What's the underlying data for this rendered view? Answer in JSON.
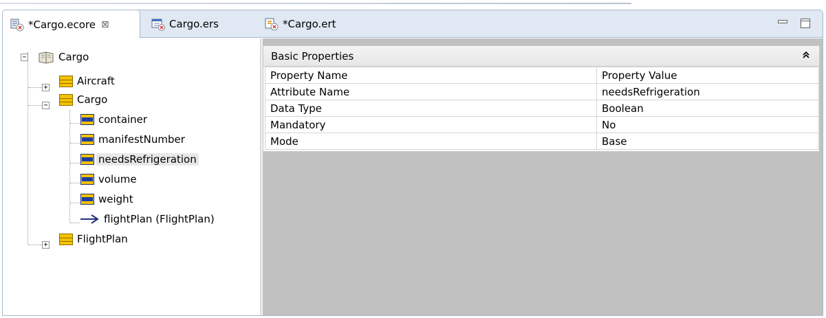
{
  "tabs": [
    {
      "label": "*Cargo.ecore",
      "active": true,
      "close": "⊠",
      "icon": "ecore-model-icon"
    },
    {
      "label": "Cargo.ers",
      "active": false,
      "icon": "ers-file-icon"
    },
    {
      "label": "*Cargo.ert",
      "active": false,
      "icon": "ert-file-icon"
    }
  ],
  "tree": {
    "root": "Cargo",
    "items": [
      {
        "label": "Aircraft",
        "icon": "eclass-icon",
        "expander": "+"
      },
      {
        "label": "Cargo",
        "icon": "eclass-icon",
        "expander": "−"
      },
      {
        "label": "container",
        "icon": "eattribute-icon"
      },
      {
        "label": "manifestNumber",
        "icon": "eattribute-icon"
      },
      {
        "label": "needsRefrigeration",
        "icon": "eattribute-icon",
        "selected": true
      },
      {
        "label": "volume",
        "icon": "eattribute-icon"
      },
      {
        "label": "weight",
        "icon": "eattribute-icon"
      },
      {
        "label": "flightPlan (FlightPlan)",
        "icon": "ereference-icon"
      },
      {
        "label": "FlightPlan",
        "icon": "eclass-icon",
        "expander": "+"
      }
    ]
  },
  "properties": {
    "section_title": "Basic Properties",
    "collapse_glyph": "⌃",
    "headers": [
      "Property Name",
      "Property Value"
    ],
    "rows": [
      [
        "Attribute Name",
        "needsRefrigeration"
      ],
      [
        "Data Type",
        "Boolean"
      ],
      [
        "Mandatory",
        "No"
      ],
      [
        "Mode",
        "Base"
      ]
    ]
  },
  "colors": {
    "tabbar_bg": "#dfe8f3",
    "class_icon": "#f5c200",
    "attr_stripe": "#1f3da0",
    "empty_area": "#c1c1c1"
  }
}
